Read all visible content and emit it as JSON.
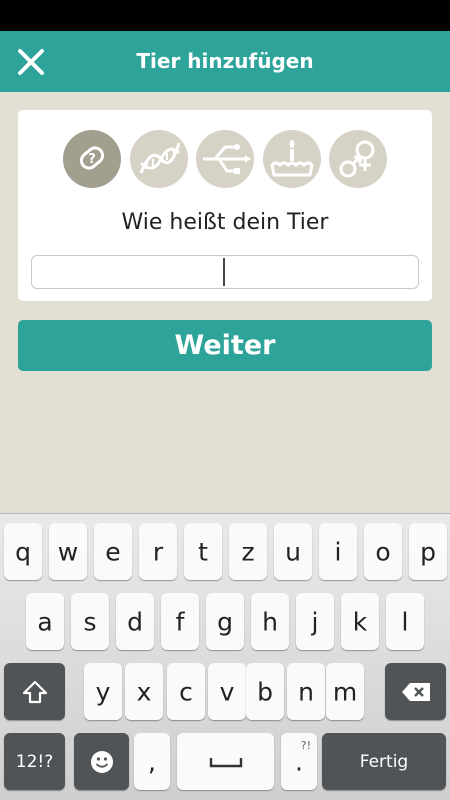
{
  "app_bar": {
    "title": "Tier hinzufügen",
    "close_icon": "close-icon",
    "background": "#2ea39a"
  },
  "steps": [
    {
      "icon": "pet-tag-icon",
      "active": true
    },
    {
      "icon": "dna-icon",
      "active": false
    },
    {
      "icon": "usb-branch-icon",
      "active": false
    },
    {
      "icon": "birthday-cake-icon",
      "active": false
    },
    {
      "icon": "gender-icon",
      "active": false
    }
  ],
  "form": {
    "question": "Wie heißt dein Tier",
    "name_value": "",
    "name_placeholder": ""
  },
  "continue_button": {
    "label": "Weiter"
  },
  "keyboard": {
    "row1": [
      "q",
      "w",
      "e",
      "r",
      "t",
      "z",
      "u",
      "i",
      "o",
      "p"
    ],
    "row2": [
      "a",
      "s",
      "d",
      "f",
      "g",
      "h",
      "j",
      "k",
      "l"
    ],
    "row3": [
      "y",
      "x",
      "c",
      "v",
      "b",
      "n",
      "m"
    ],
    "mode_key": "12!?",
    "comma_key": ",",
    "period_key": ".",
    "period_hint": "?!",
    "done_key": "Fertig"
  },
  "colors": {
    "accent": "#2ea39a",
    "background": "#e2e0d5",
    "step_inactive": "#d6d3c6",
    "step_active": "#a29f8f"
  }
}
